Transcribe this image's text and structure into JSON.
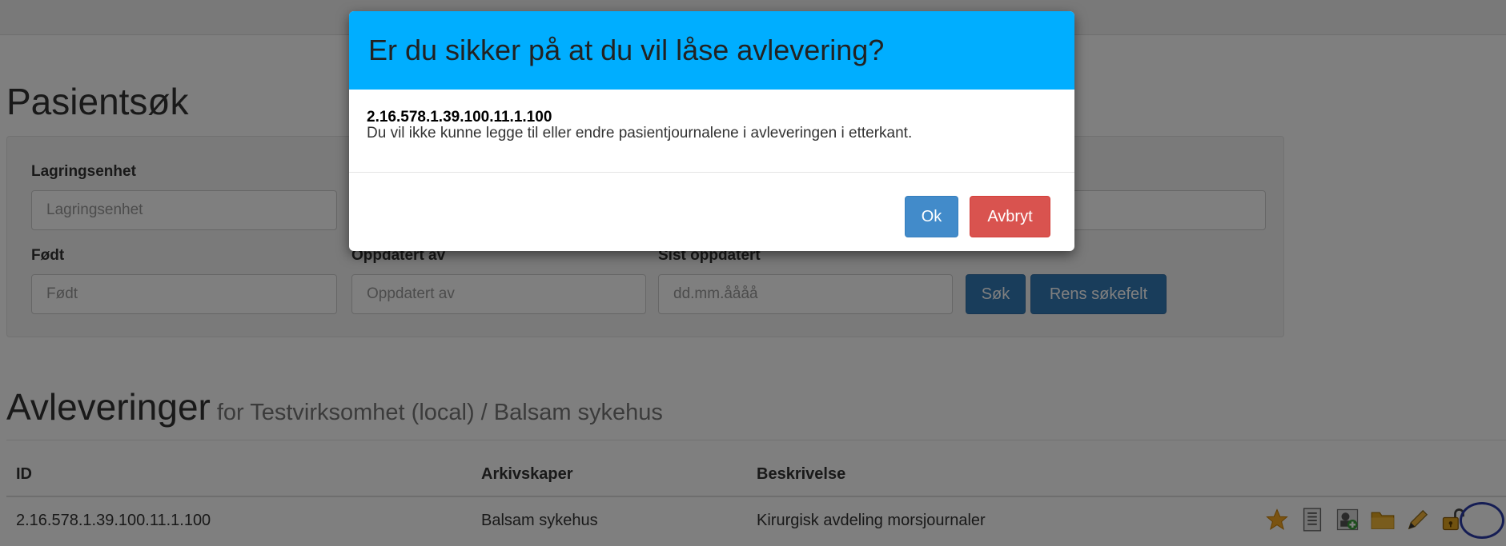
{
  "page": {
    "title": "Pasientsøk"
  },
  "search": {
    "fields": [
      {
        "label": "Lagringsenhet",
        "placeholder": "Lagringsenhet"
      },
      {
        "label": "Født",
        "placeholder": "Født"
      },
      {
        "label": "Oppdatert av",
        "placeholder": "Oppdatert av"
      },
      {
        "label": "Sist oppdatert",
        "placeholder": "dd.mm.åååå"
      }
    ],
    "search_button": "Søk",
    "clear_button": "Rens søkefelt"
  },
  "deliveries": {
    "title": "Avleveringer",
    "subtitle": "for Testvirksomhet (local) / Balsam sykehus",
    "columns": [
      "ID",
      "Arkivskaper",
      "Beskrivelse"
    ],
    "rows": [
      {
        "id": "2.16.578.1.39.100.11.1.100",
        "archive_creator": "Balsam sykehus",
        "description": "Kirurgisk avdeling morsjournaler",
        "icons": [
          "star-icon",
          "document-list-icon",
          "add-user-icon",
          "folder-icon",
          "pencil-icon",
          "lock-open-icon"
        ]
      }
    ]
  },
  "modal": {
    "title": "Er du sikker på at du vil låse avlevering?",
    "id": "2.16.578.1.39.100.11.1.100",
    "message": "Du vil ikke kunne legge til eller endre pasientjournalene i avleveringen i etterkant.",
    "ok_label": "Ok",
    "cancel_label": "Avbryt"
  },
  "colors": {
    "modal_header": "#00aeff",
    "primary": "#337ab7",
    "danger": "#d9534f",
    "highlight": "#2a3aa8"
  }
}
